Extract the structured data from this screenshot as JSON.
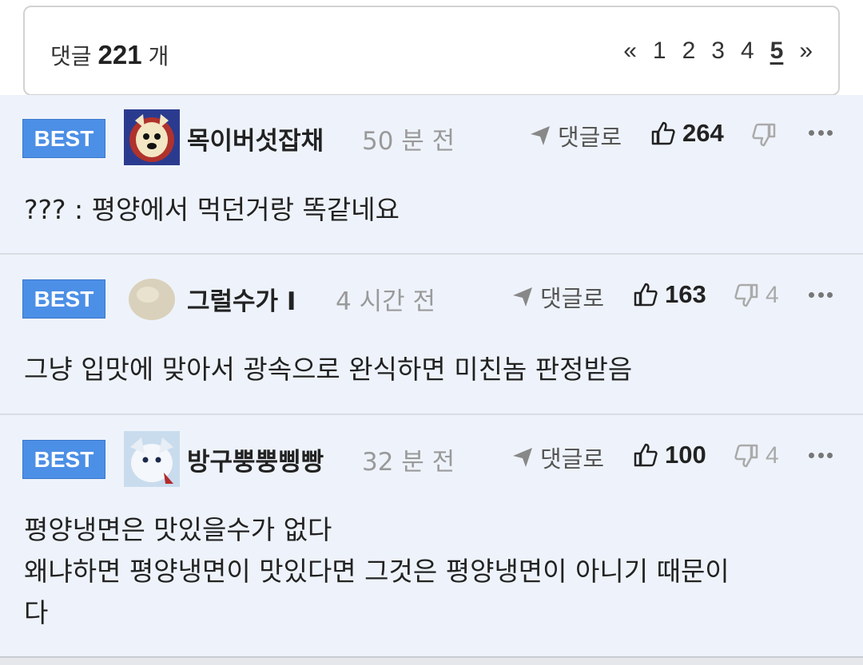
{
  "header": {
    "comment_prefix": "댓글",
    "comment_count": "221",
    "comment_suffix": "개",
    "pagination": {
      "prev": "«",
      "pages": [
        "1",
        "2",
        "3",
        "4",
        "5"
      ],
      "current": "5",
      "next": "»"
    }
  },
  "comments": [
    {
      "badge": "BEST",
      "nickname": "목이버섯잡채",
      "time": "50 분 전",
      "reply_label": "댓글로",
      "likes": "264",
      "dislikes": "",
      "text": "??? : 평양에서 먹던거랑 똑같네요"
    },
    {
      "badge": "BEST",
      "nickname": "그럴수가 I",
      "time": "4 시간 전",
      "reply_label": "댓글로",
      "likes": "163",
      "dislikes": "4",
      "text": "그냥 입맛에 맞아서 광속으로 완식하면 미친놈 판정받음"
    },
    {
      "badge": "BEST",
      "nickname": "방구뿡뿡삥빵",
      "time": "32 분 전",
      "reply_label": "댓글로",
      "likes": "100",
      "dislikes": "4",
      "text": "평양냉면은 맛있을수가 없다\n왜냐하면 평양냉면이 맛있다면 그것은 평양냉면이 아니기 때문이\n다"
    }
  ],
  "icons": {
    "reply": "reply-arrow-icon",
    "like": "thumbs-up-icon",
    "dislike": "thumbs-down-icon",
    "more": "more-dots-icon"
  },
  "colors": {
    "best_badge": "#4c8fe6",
    "comment_bg": "#eef3fb"
  }
}
